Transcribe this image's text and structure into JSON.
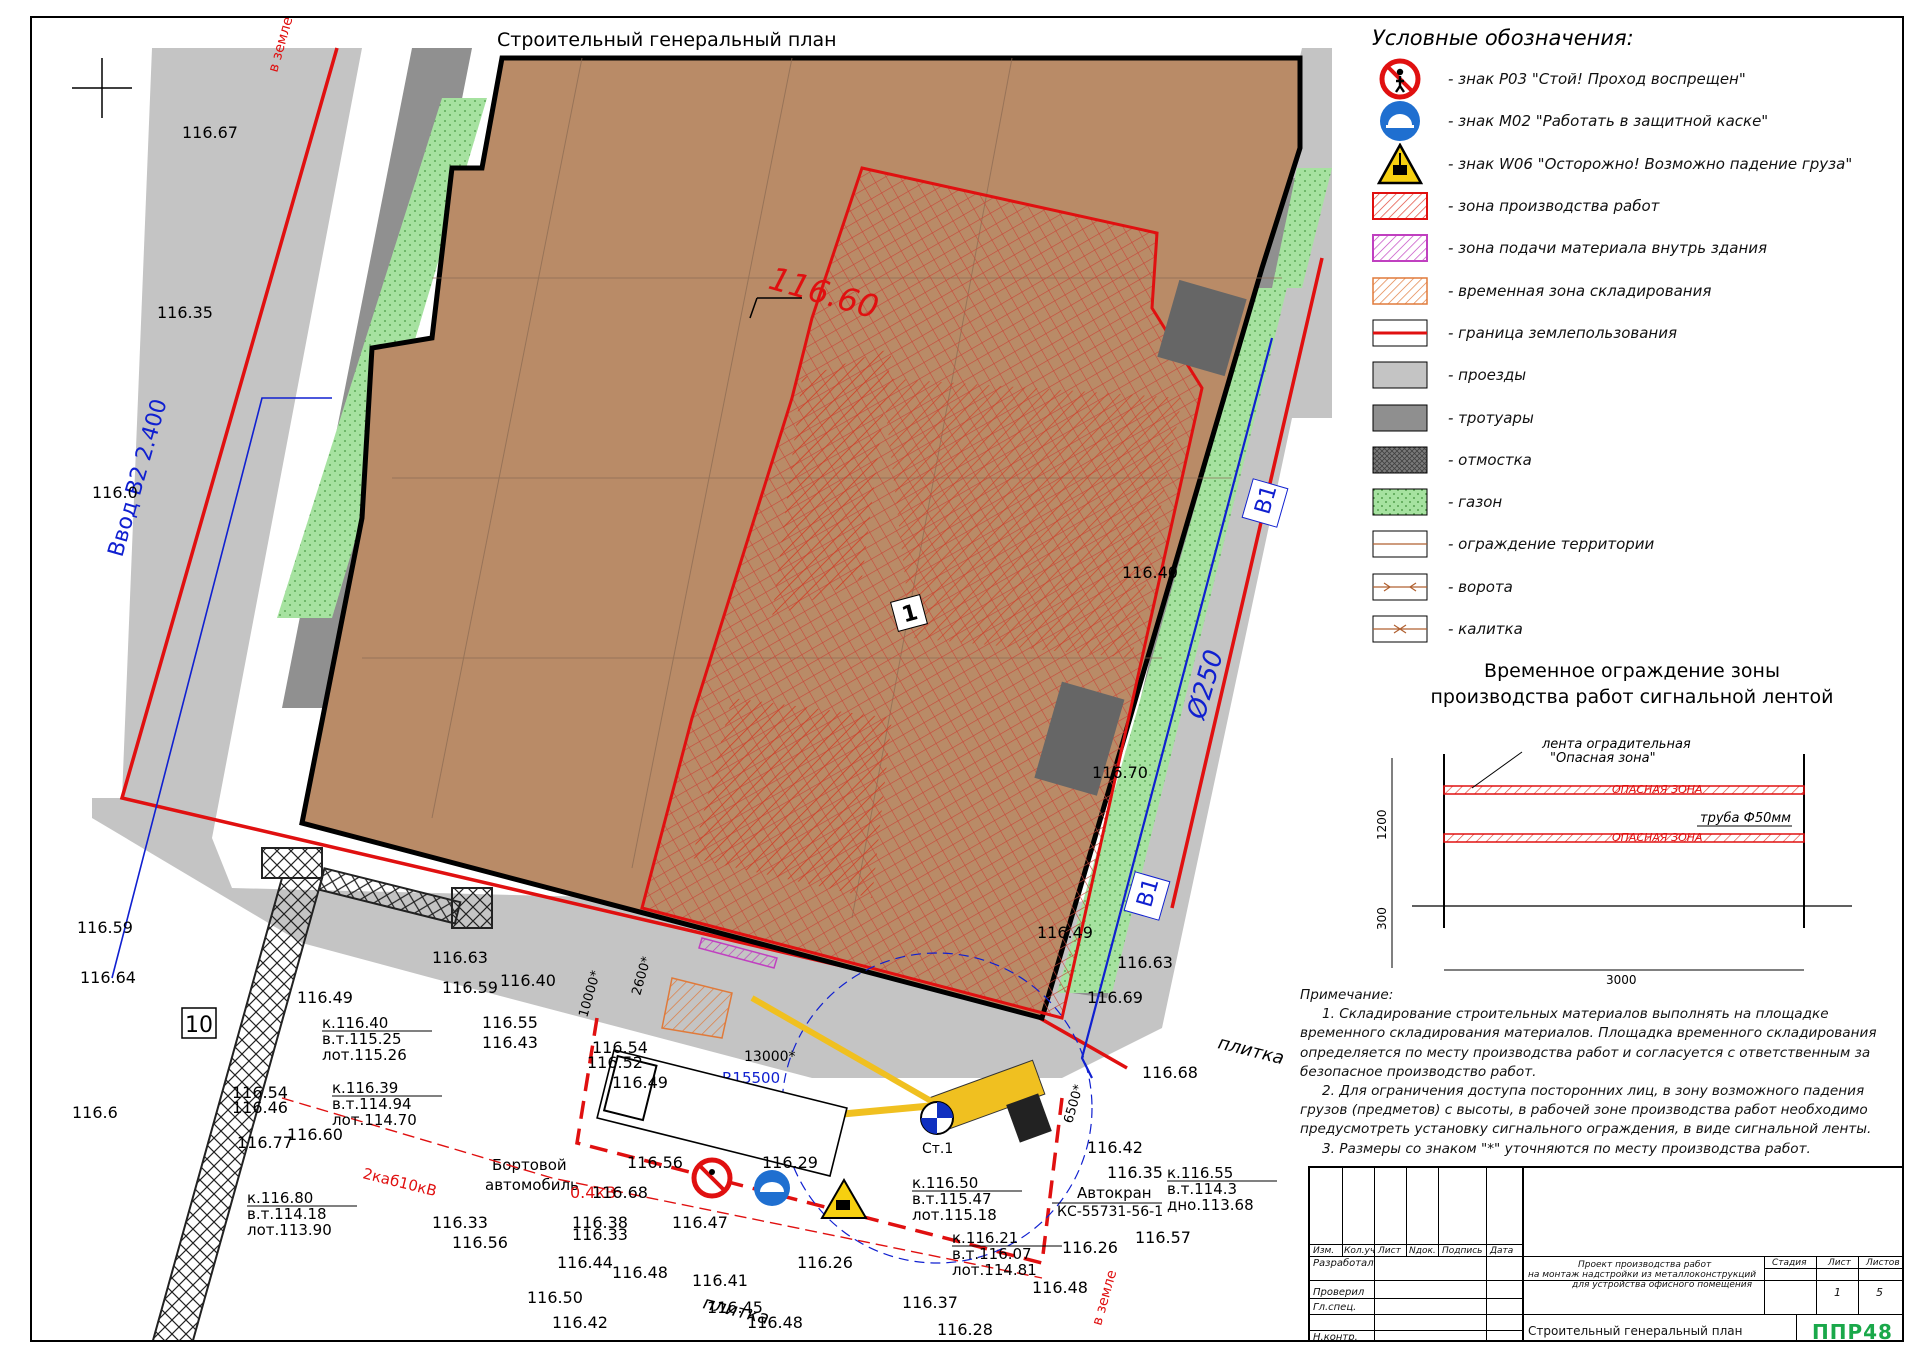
{
  "sheet": {
    "plan_title": "Строительный генеральный план",
    "building_number": "1",
    "elevation_main": "116.60",
    "water_label": "В1",
    "pipe_diameter": "Ø250",
    "water_inlet": "Ввод В2 2.400",
    "road_number": "10",
    "crane_post": "Ст.1",
    "crane_label": "Автокран",
    "crane_model": "КС-55731-56-1",
    "truck_label_1": "Бортовой",
    "truck_label_2": "автомобиль",
    "radius_label": "R15500",
    "dim_13000": "13000*",
    "dim_2600": "2600*",
    "dim_10000": "10000*",
    "dim_6500": "6500*",
    "cable_label": "0.4кВ",
    "cable_label_2": "2каб10кВ",
    "tile_label": "плитка",
    "in_ground": "в земле",
    "elevations": [
      "116.67",
      "116.35",
      "116.0",
      "116.59",
      "116.64",
      "116.49",
      "116.63",
      "116.59",
      "116.40",
      "116.54",
      "116.55",
      "116.43",
      "116.52",
      "116.49",
      "116.54",
      "116.46",
      "116.60",
      "116.6",
      "116.77",
      "116.68",
      "116.38",
      "116.33",
      "116.47",
      "116.33",
      "116.56",
      "116.56",
      "116.44",
      "116.48",
      "116.41",
      "116.50",
      "116.42",
      "116.26",
      "116.45",
      "116.48",
      "116.28",
      "116.37",
      "116.48",
      "116.49",
      "116.69",
      "116.63",
      "116.42",
      "116.35",
      "116.26",
      "116.57",
      "116.68",
      "116.29",
      "116.70",
      "116.40"
    ],
    "callouts": [
      {
        "k": "к.116.40",
        "v": "в.т.115.25",
        "l": "лот.115.26"
      },
      {
        "k": "к.116.39",
        "v": "в.т.114.94",
        "l": "лот.114.70"
      },
      {
        "k": "к.116.80",
        "v": "в.т.114.18",
        "l": "лот.113.90"
      },
      {
        "k": "к.116.50",
        "v": "в.т.115.47",
        "l": "лот.115.18"
      },
      {
        "k": "к.116.21",
        "v": "в.т.116.07",
        "l": "лот.114.81"
      },
      {
        "k": "к.116.55",
        "v": "в.т.114.3",
        "l": "дно.113.68"
      }
    ]
  },
  "legend": {
    "title": "Условные обозначения:",
    "items": [
      {
        "sym": "sign-stop",
        "label": "- знак Р03 \"Стой! Проход воспрещен\""
      },
      {
        "sym": "sign-helmet",
        "label": "- знак М02 \"Работать в защитной каске\""
      },
      {
        "sym": "sign-load",
        "label": "- знак W06 \"Осторожно! Возможно падение груза\""
      },
      {
        "sym": "work-zone",
        "label": "- зона производства работ"
      },
      {
        "sym": "supply-zone",
        "label": "- зона подачи материала внутрь здания"
      },
      {
        "sym": "storage-zone",
        "label": "- временная зона складирования"
      },
      {
        "sym": "boundary",
        "label": "- граница землепользования"
      },
      {
        "sym": "driveway",
        "label": "- проезды"
      },
      {
        "sym": "sidewalk",
        "label": "- тротуары"
      },
      {
        "sym": "blind-area",
        "label": "- отмостка"
      },
      {
        "sym": "lawn",
        "label": "- газон"
      },
      {
        "sym": "fence",
        "label": "- ограждение территории"
      },
      {
        "sym": "gate",
        "label": "- ворота"
      },
      {
        "sym": "wicket",
        "label": "- калитка"
      }
    ]
  },
  "fence_detail": {
    "title_1": "Временное ограждение зоны",
    "title_2": "производства работ сигнальной лентой",
    "tape_label_1": "лента оградительная",
    "tape_label_2": "\"Опасная зона\"",
    "tape_text": "ОПАСНАЯ ЗОНА",
    "pipe_label": "труба Ф50мм",
    "dim_height": "1200",
    "dim_depth": "300",
    "dim_width": "3000"
  },
  "notes": {
    "heading": "Примечание:",
    "items": [
      "1. Складирование строительных материалов выполнять на площадке временного складирования материалов. Площадка временного складирования определяется по месту производства работ и согласуется с ответственным за безопасное производство работ.",
      "2. Для ограничения доступа посторонних лиц, в зону возможного падения грузов (предметов) с высоты, в рабочей зоне производства работ необходимо предусмотреть установку сигнального ограждения, в виде сигнальной ленты.",
      "3. Размеры со знаком \"*\" уточняются по месту производства работ."
    ]
  },
  "stamp": {
    "col_izm": "Изм.",
    "col_kol": "Кол.уч",
    "col_list": "Лист",
    "col_ndok": "Nдок.",
    "col_podp": "Подпись",
    "col_data": "Дата",
    "row_razrab": "Разработал",
    "row_proveril": "Проверил",
    "row_glspec": "Гл.спец.",
    "row_nkontr": "Н.контр.",
    "project_1": "Проект производства работ",
    "project_2": "на монтаж надстройки из металлоконструкций",
    "project_3": "для устройства офисного помещения",
    "stage": "Стадия",
    "sheet": "Лист",
    "sheets": "Листов",
    "sheet_no": "1",
    "sheets_total": "5",
    "drawing_name": "Строительный генеральный план",
    "company": "ППР48",
    "company_color": "#1aa84a"
  },
  "colors": {
    "building": "#b98b67",
    "work_zone": "#e06040",
    "boundary": "#e01010",
    "road": "#bdbdbd",
    "sidewalk": "#8f8f8f",
    "lawn": "#a6e2a0",
    "storage": "#f0a070",
    "supply": "#c040c0",
    "water": "#1020d0"
  }
}
